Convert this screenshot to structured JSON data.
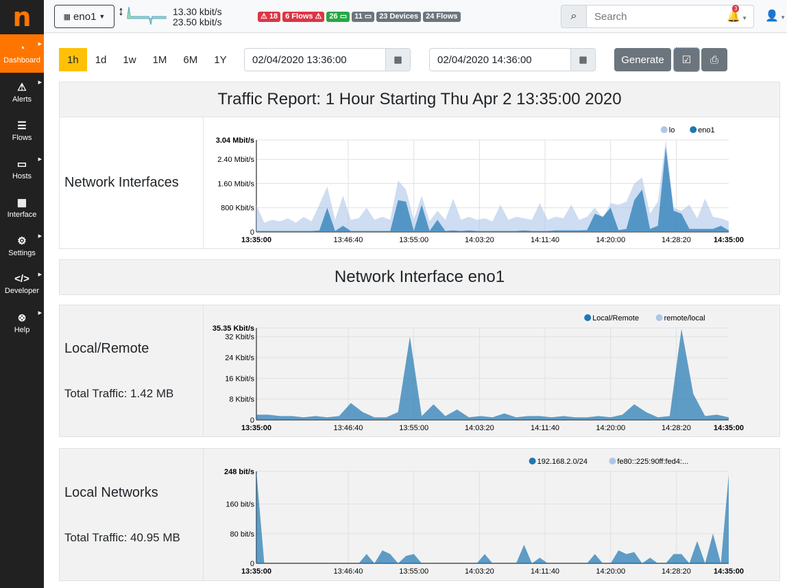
{
  "sidebar": {
    "logo": "n",
    "items": [
      {
        "label": "Dashboard",
        "icon": "gauge-icon",
        "glyph": "◔",
        "active": true,
        "caret": true
      },
      {
        "label": "Alerts",
        "icon": "warning-icon",
        "glyph": "⚠",
        "caret": true
      },
      {
        "label": "Flows",
        "icon": "stream-icon",
        "glyph": "☰",
        "caret": false
      },
      {
        "label": "Hosts",
        "icon": "laptop-icon",
        "glyph": "▭",
        "caret": true
      },
      {
        "label": "Interface",
        "icon": "ethernet-icon",
        "glyph": "▦",
        "caret": false
      },
      {
        "label": "Settings",
        "icon": "gear-icon",
        "glyph": "⚙",
        "caret": true
      },
      {
        "label": "Developer",
        "icon": "code-icon",
        "glyph": "</>",
        "caret": true
      },
      {
        "label": "Help",
        "icon": "life-ring-icon",
        "glyph": "⊗",
        "caret": true
      }
    ]
  },
  "topbar": {
    "interface": "eno1",
    "upload": "13.30 kbit/s",
    "download": "23.50 kbit/s",
    "badges": [
      {
        "text": "⚠ 18",
        "color": "red"
      },
      {
        "text": "6 Flows ⚠",
        "color": "red"
      },
      {
        "text": "26 ▭",
        "color": "green"
      },
      {
        "text": "11 ▭",
        "color": "grey"
      },
      {
        "text": "23 Devices",
        "color": "grey"
      },
      {
        "text": "24 Flows",
        "color": "grey"
      }
    ],
    "search_placeholder": "Search",
    "notifications": "3"
  },
  "controls": {
    "ranges": [
      "1h",
      "1d",
      "1w",
      "1M",
      "6M",
      "1Y"
    ],
    "selected_range": "1h",
    "start": "02/04/2020 13:36:00",
    "end": "02/04/2020 14:36:00",
    "generate": "Generate"
  },
  "report": {
    "title": "Traffic Report: 1 Hour Starting Thu Apr 2 13:35:00 2020",
    "section": "Network Interface eno1",
    "rows": [
      {
        "label": "Network Interfaces",
        "total": ""
      },
      {
        "label": "Local/Remote",
        "total": "Total Traffic: 1.42 MB"
      },
      {
        "label": "Local Networks",
        "total": "Total Traffic: 40.95 MB"
      }
    ]
  },
  "chart_data": [
    {
      "type": "area",
      "ylabel": "",
      "xlabel": "",
      "xticks": [
        "13:35:00",
        "13:46:40",
        "13:55:00",
        "14:03:20",
        "14:11:40",
        "14:20:00",
        "14:28:20",
        "14:35:00"
      ],
      "yticks": [
        "0",
        "800 Kbit/s",
        "1.60 Mbit/s",
        "2.40 Mbit/s",
        "3.04 Mbit/s"
      ],
      "ytick_values": [
        0,
        0.8,
        1.6,
        2.4,
        3.04
      ],
      "ylim": [
        0,
        3.04
      ],
      "unit": "Mbit/s",
      "legend": "top-right",
      "grid": true,
      "x_minutes": [
        0,
        1,
        2,
        3,
        4,
        5,
        6,
        7,
        8,
        9,
        10,
        11,
        12,
        13,
        14,
        15,
        16,
        17,
        18,
        19,
        20,
        21,
        22,
        23,
        24,
        25,
        26,
        27,
        28,
        29,
        30,
        31,
        32,
        33,
        34,
        35,
        36,
        37,
        38,
        39,
        40,
        41,
        42,
        43,
        44,
        45,
        46,
        47,
        48,
        49,
        50,
        51,
        52,
        53,
        54,
        55,
        56,
        57,
        58,
        59,
        60
      ],
      "series": [
        {
          "name": "lo",
          "color": "#aec7e8",
          "values": [
            0.9,
            0.3,
            0.4,
            0.35,
            0.45,
            0.3,
            0.5,
            0.35,
            0.9,
            1.5,
            0.4,
            1.2,
            0.4,
            0.45,
            0.8,
            0.4,
            0.5,
            0.4,
            1.7,
            1.4,
            0.4,
            1.2,
            0.35,
            0.7,
            0.4,
            1.1,
            0.4,
            0.5,
            0.4,
            0.45,
            0.35,
            0.9,
            0.4,
            0.5,
            0.45,
            0.4,
            0.95,
            0.4,
            0.5,
            0.45,
            0.9,
            0.4,
            0.5,
            0.8,
            0.45,
            0.95,
            0.9,
            1.0,
            1.6,
            1.8,
            0.6,
            1.0,
            3.04,
            0.8,
            0.7,
            0.9,
            0.45,
            1.1,
            0.5,
            0.45,
            0.35
          ]
        },
        {
          "name": "eno1",
          "color": "#1f77b4",
          "values": [
            0.03,
            0.03,
            0.03,
            0.03,
            0.03,
            0.03,
            0.03,
            0.03,
            0.05,
            0.8,
            0.03,
            0.2,
            0.03,
            0.03,
            0.03,
            0.03,
            0.03,
            0.03,
            1.05,
            1.0,
            0.03,
            0.9,
            0.03,
            0.4,
            0.03,
            0.05,
            0.03,
            0.05,
            0.03,
            0.03,
            0.03,
            0.03,
            0.03,
            0.03,
            0.05,
            0.03,
            0.03,
            0.03,
            0.05,
            0.05,
            0.05,
            0.05,
            0.06,
            0.6,
            0.5,
            0.8,
            0.06,
            0.1,
            1.05,
            1.4,
            0.1,
            0.2,
            2.8,
            0.7,
            0.6,
            0.1,
            0.1,
            0.1,
            0.1,
            0.2,
            0.05
          ]
        }
      ]
    },
    {
      "type": "area",
      "xticks": [
        "13:35:00",
        "13:46:40",
        "13:55:00",
        "14:03:20",
        "14:11:40",
        "14:20:00",
        "14:28:20",
        "14:35:00"
      ],
      "yticks": [
        "0",
        "8 Kbit/s",
        "16 Kbit/s",
        "24 Kbit/s",
        "32 Kbit/s",
        "35.35 Kbit/s"
      ],
      "ytick_values": [
        0,
        8,
        16,
        24,
        32,
        35.35
      ],
      "ylim": [
        0,
        35.35
      ],
      "unit": "Kbit/s",
      "legend": "top-right",
      "grid": true,
      "x_minutes": [
        0,
        1.5,
        3,
        4.5,
        6,
        7.5,
        9,
        10.5,
        12,
        13.5,
        15,
        16.5,
        18,
        19.5,
        21,
        22.5,
        24,
        25.5,
        27,
        28.5,
        30,
        31.5,
        33,
        34.5,
        36,
        37.5,
        39,
        40.5,
        42,
        43.5,
        45,
        46.5,
        48,
        49.5,
        51,
        52.5,
        54,
        55.5,
        57,
        58.5,
        60
      ],
      "series": [
        {
          "name": "Local/Remote",
          "color": "#1f77b4",
          "values": [
            2,
            2,
            1.5,
            1.5,
            1,
            1.5,
            1,
            1.5,
            6.5,
            3,
            1,
            1,
            3,
            32,
            1.5,
            6,
            1.5,
            4,
            1,
            1.5,
            1,
            2.5,
            1,
            1.5,
            1.5,
            1,
            1.5,
            1,
            1,
            1.5,
            1,
            2,
            6,
            3,
            1,
            1.5,
            35,
            10,
            1.5,
            2,
            1
          ]
        },
        {
          "name": "remote/local",
          "color": "#aec7e8",
          "values": [
            0,
            0,
            0,
            0,
            0,
            0,
            0,
            0,
            0,
            0,
            0,
            0,
            0,
            0,
            0,
            0,
            0,
            0,
            0,
            0,
            0,
            0,
            0,
            0,
            0,
            0,
            0,
            0,
            0,
            0,
            0,
            0,
            0,
            0,
            0,
            0,
            0,
            0,
            0,
            0,
            0
          ]
        }
      ]
    },
    {
      "type": "area",
      "xticks": [
        "13:35:00",
        "13:46:40",
        "13:55:00",
        "14:03:20",
        "14:11:40",
        "14:20:00",
        "14:28:20",
        "14:35:00"
      ],
      "yticks": [
        "0",
        "80 bit/s",
        "160 bit/s",
        "248 bit/s"
      ],
      "ytick_values": [
        0,
        80,
        160,
        248
      ],
      "ylim": [
        0,
        248
      ],
      "unit": "bit/s",
      "legend": "top-right",
      "grid": true,
      "x_minutes": [
        0,
        1,
        2,
        3,
        4,
        5,
        6,
        7,
        8,
        9,
        10,
        11,
        12,
        13,
        14,
        15,
        16,
        17,
        18,
        19,
        20,
        21,
        22,
        23,
        24,
        25,
        26,
        27,
        28,
        29,
        30,
        31,
        32,
        33,
        34,
        35,
        36,
        37,
        38,
        39,
        40,
        41,
        42,
        43,
        44,
        45,
        46,
        47,
        48,
        49,
        50,
        51,
        52,
        53,
        54,
        55,
        56,
        57,
        58,
        59,
        60
      ],
      "series": [
        {
          "name": "192.168.2.0/24",
          "color": "#1f77b4",
          "values": [
            248,
            0,
            0,
            0,
            0,
            0,
            0,
            0,
            0,
            0,
            0,
            0,
            0,
            0,
            25,
            0,
            35,
            25,
            0,
            20,
            25,
            0,
            0,
            0,
            0,
            0,
            0,
            0,
            0,
            25,
            0,
            0,
            0,
            0,
            50,
            0,
            15,
            0,
            0,
            0,
            0,
            0,
            0,
            25,
            0,
            0,
            35,
            25,
            30,
            0,
            15,
            0,
            0,
            25,
            25,
            0,
            60,
            0,
            80,
            0,
            240
          ]
        },
        {
          "name": "fe80::225:90ff:fed4:...",
          "color": "#aec7e8",
          "values": [
            0,
            0,
            0,
            0,
            0,
            0,
            0,
            0,
            0,
            0,
            0,
            0,
            0,
            0,
            0,
            0,
            0,
            0,
            0,
            0,
            0,
            0,
            0,
            0,
            0,
            0,
            0,
            0,
            0,
            0,
            0,
            0,
            0,
            0,
            0,
            0,
            0,
            0,
            0,
            0,
            0,
            0,
            0,
            0,
            0,
            0,
            0,
            0,
            0,
            0,
            0,
            0,
            0,
            0,
            0,
            0,
            0,
            0,
            0,
            0,
            0
          ]
        }
      ]
    }
  ]
}
